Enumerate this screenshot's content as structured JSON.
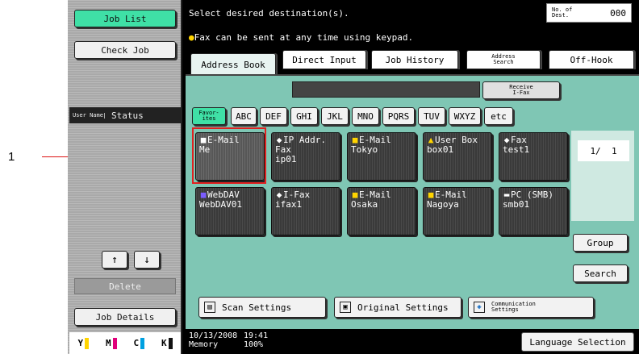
{
  "callout": {
    "number": "1"
  },
  "left_panel": {
    "job_list": "Job List",
    "check_job": "Check Job",
    "user_name_header": "User Name",
    "status_header": "Status",
    "up_arrow": "↑",
    "down_arrow": "↓",
    "delete": "Delete",
    "job_details": "Job Details",
    "toner": [
      {
        "label": "Y",
        "color": "#ffd400"
      },
      {
        "label": "M",
        "color": "#e0007a"
      },
      {
        "label": "C",
        "color": "#00a0e0"
      },
      {
        "label": "K",
        "color": "#111111"
      }
    ]
  },
  "header": {
    "message": "Select desired destination(s).",
    "hint": "Fax can be sent at any time using keypad.",
    "dest_label_1": "No. of",
    "dest_label_2": "Dest.",
    "dest_count": "000"
  },
  "tabs": {
    "address_book": "Address Book",
    "direct_input": "Direct Input",
    "job_history": "Job History",
    "address_search_1": "Address",
    "address_search_2": "Search",
    "off_hook": "Off-Hook"
  },
  "receive": {
    "line1": "Receive",
    "line2": "I-Fax"
  },
  "index": {
    "favorites_1": "Favor-",
    "favorites_2": "ites",
    "keys": [
      "ABC",
      "DEF",
      "GHI",
      "JKL",
      "MNO",
      "PQRS",
      "TUV",
      "WXYZ",
      "etc"
    ]
  },
  "entries": [
    {
      "type": "E-Mail",
      "name": "Me",
      "icon": "email-icon"
    },
    {
      "type": "IP Addr. Fax",
      "name": "ip01",
      "icon": "ip-fax-icon"
    },
    {
      "type": "E-Mail",
      "name": "Tokyo",
      "icon": "email-icon"
    },
    {
      "type": "User Box",
      "name": "box01",
      "icon": "user-box-icon"
    },
    {
      "type": "Fax",
      "name": "test1",
      "icon": "fax-icon"
    },
    {
      "type": "WebDAV",
      "name": "WebDAV01",
      "icon": "webdav-icon"
    },
    {
      "type": "I-Fax",
      "name": "ifax1",
      "icon": "ifax-icon"
    },
    {
      "type": "E-Mail",
      "name": "Osaka",
      "icon": "email-icon"
    },
    {
      "type": "E-Mail",
      "name": "Nagoya",
      "icon": "email-icon"
    },
    {
      "type": "PC (SMB)",
      "name": "smb01",
      "icon": "pc-smb-icon"
    }
  ],
  "pager": {
    "current": "1/",
    "total": "1"
  },
  "right_buttons": {
    "group": "Group",
    "search": "Search"
  },
  "bottom": {
    "scan_settings": "Scan Settings",
    "original_settings": "Original Settings",
    "communication_1": "Communication",
    "communication_2": "Settings"
  },
  "footer": {
    "date": "10/13/2008",
    "time": "19:41",
    "memory_label": "Memory",
    "memory_value": "100%",
    "language": "Language Selection"
  }
}
